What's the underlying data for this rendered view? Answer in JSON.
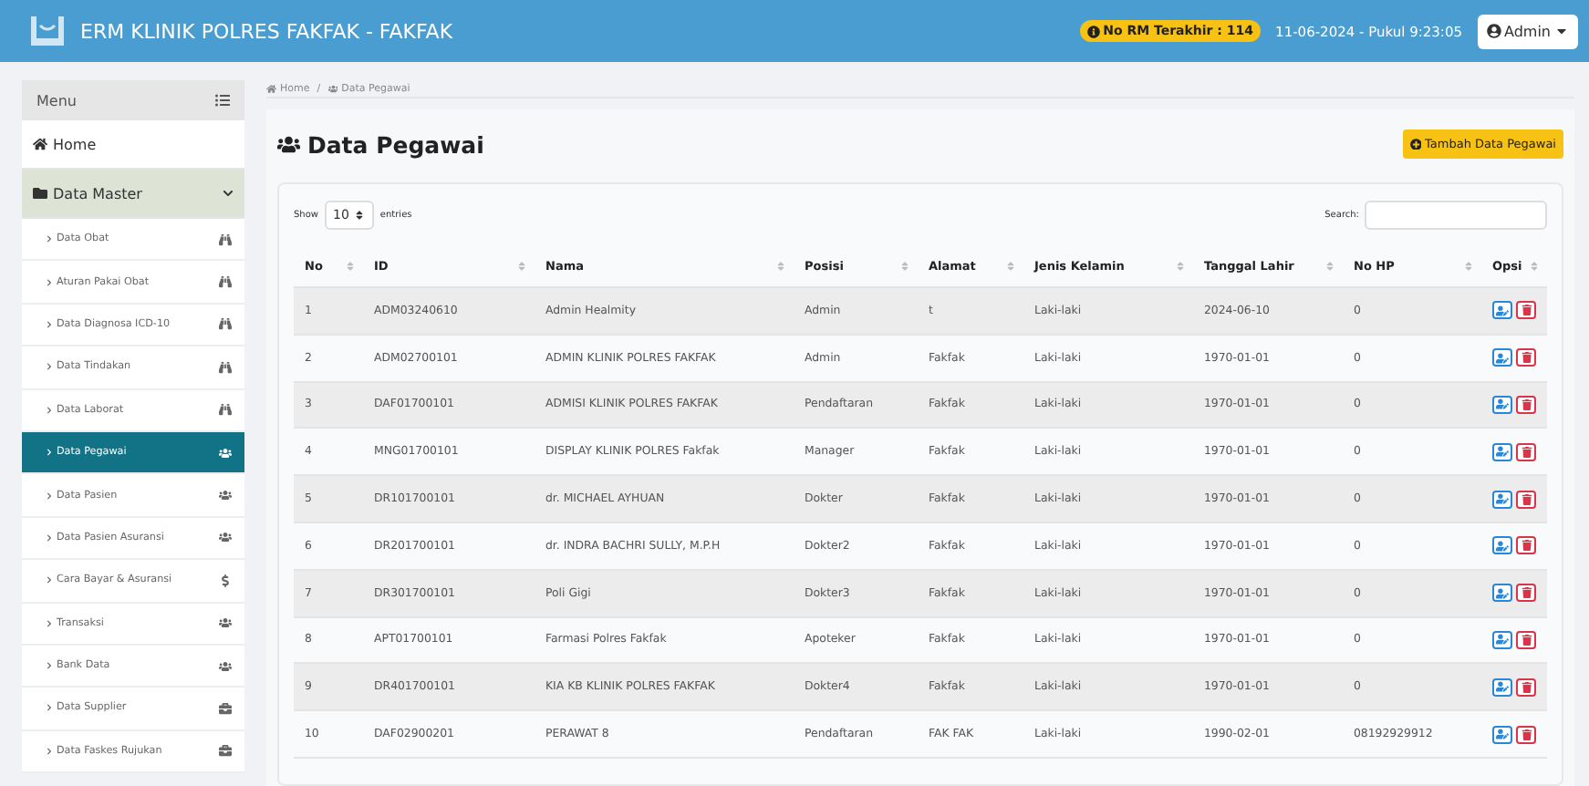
{
  "topbar": {
    "title": "ERM KLINIK POLRES FAKFAK - FAKFAK",
    "badge": "No RM Terakhir : 114",
    "datetime": "11-06-2024 - Pukul 9:23:05",
    "user": "Admin"
  },
  "sidebar": {
    "header": "Menu",
    "home": "Home",
    "group": {
      "label": "Data Master",
      "expanded": true,
      "items": [
        {
          "label": "Data Obat",
          "selected": false
        },
        {
          "label": "Aturan Pakai Obat",
          "selected": false
        },
        {
          "label": "Data Diagnosa ICD-10",
          "selected": false
        },
        {
          "label": "Data Tindakan",
          "selected": false
        },
        {
          "label": "Data Laborat",
          "selected": false
        },
        {
          "label": "Data Pegawai",
          "selected": true
        },
        {
          "label": "Data Pasien",
          "selected": false
        },
        {
          "label": "Data Pasien Asuransi",
          "selected": false
        },
        {
          "label": "Cara Bayar & Asuransi",
          "selected": false
        },
        {
          "label": "Transaksi",
          "selected": false
        },
        {
          "label": "Bank Data",
          "selected": false
        },
        {
          "label": "Data Supplier",
          "selected": false
        },
        {
          "label": "Data Faskes Rujukan",
          "selected": false
        }
      ]
    }
  },
  "breadcrumb": [
    "Home",
    "Data Pegawai"
  ],
  "breadcrumb_separator": "/",
  "page_title": "Data Pegawai",
  "add_button": "Tambah Data Pegawai",
  "table_controls": {
    "show": "Show",
    "entries_value": "10",
    "entries": "entries",
    "search": "Search:"
  },
  "table": {
    "columns": [
      "No",
      "ID",
      "Nama",
      "Posisi",
      "Alamat",
      "Jenis Kelamin",
      "Tanggal Lahir",
      "No HP",
      "Opsi"
    ],
    "rows": [
      [
        "1",
        "ADM03240610",
        "Admin Healmity",
        "Admin",
        "t",
        "Laki-laki",
        "2024-06-10",
        "0"
      ],
      [
        "2",
        "ADM02700101",
        "ADMIN KLINIK POLRES FAKFAK",
        "Admin",
        "Fakfak",
        "Laki-laki",
        "1970-01-01",
        "0"
      ],
      [
        "3",
        "DAF01700101",
        "ADMISI KLINIK POLRES FAKFAK",
        "Pendaftaran",
        "Fakfak",
        "Laki-laki",
        "1970-01-01",
        "0"
      ],
      [
        "4",
        "MNG01700101",
        "DISPLAY KLINIK POLRES Fakfak",
        "Manager",
        "Fakfak",
        "Laki-laki",
        "1970-01-01",
        "0"
      ],
      [
        "5",
        "DR101700101",
        "dr. MICHAEL AYHUAN",
        "Dokter",
        "Fakfak",
        "Laki-laki",
        "1970-01-01",
        "0"
      ],
      [
        "6",
        "DR201700101",
        "dr. INDRA BACHRI SULLY, M.P.H",
        "Dokter2",
        "Fakfak",
        "Laki-laki",
        "1970-01-01",
        "0"
      ],
      [
        "7",
        "DR301700101",
        "Poli Gigi",
        "Dokter3",
        "Fakfak",
        "Laki-laki",
        "1970-01-01",
        "0"
      ],
      [
        "8",
        "APT01700101",
        "Farmasi Polres Fakfak",
        "Apoteker",
        "Fakfak",
        "Laki-laki",
        "1970-01-01",
        "0"
      ],
      [
        "9",
        "DR401700101",
        "KIA KB KLINIK POLRES FAKFAK",
        "Dokter4",
        "Fakfak",
        "Laki-laki",
        "1970-01-01",
        "0"
      ],
      [
        "10",
        "DAF02900201",
        "PERAWAT 8",
        "Pendaftaran",
        "FAK FAK",
        "Laki-laki",
        "1990-02-01",
        "08192929912"
      ]
    ]
  }
}
